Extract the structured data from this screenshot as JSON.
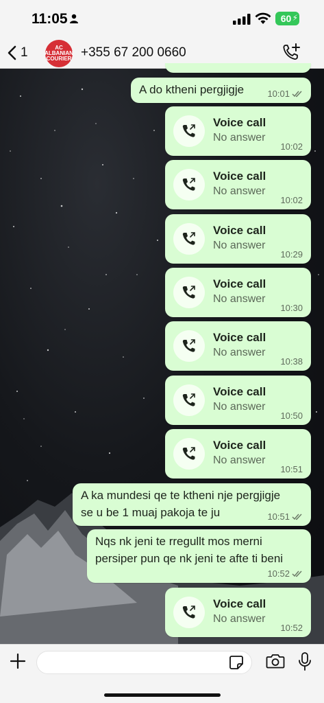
{
  "status_bar": {
    "time": "11:05",
    "battery": "60"
  },
  "header": {
    "back_count": "1",
    "avatar_text": "AC ALBANIAN COURIER",
    "contact": "+355 67 200 0660"
  },
  "messages": [
    {
      "type": "text",
      "text": "A do ktheni pergjigje",
      "time": "10:01",
      "read": true
    },
    {
      "type": "call",
      "title": "Voice call",
      "subtitle": "No answer",
      "time": "10:02"
    },
    {
      "type": "call",
      "title": "Voice call",
      "subtitle": "No answer",
      "time": "10:02"
    },
    {
      "type": "call",
      "title": "Voice call",
      "subtitle": "No answer",
      "time": "10:29"
    },
    {
      "type": "call",
      "title": "Voice call",
      "subtitle": "No answer",
      "time": "10:30"
    },
    {
      "type": "call",
      "title": "Voice call",
      "subtitle": "No answer",
      "time": "10:38"
    },
    {
      "type": "call",
      "title": "Voice call",
      "subtitle": "No answer",
      "time": "10:50"
    },
    {
      "type": "call",
      "title": "Voice call",
      "subtitle": "No answer",
      "time": "10:51"
    },
    {
      "type": "text",
      "line1": "A ka mundesi qe te ktheni nje pergjigje",
      "line2": "se u be 1 muaj pakoja te ju",
      "time": "10:51",
      "read": true
    },
    {
      "type": "text",
      "line1": "Nqs nk jeni te rregullt mos merni",
      "line2": "persiper pun qe nk jeni te afte ti beni",
      "time": "10:52",
      "read": true
    },
    {
      "type": "call",
      "title": "Voice call",
      "subtitle": "No answer",
      "time": "10:52"
    }
  ],
  "input": {
    "value": "",
    "placeholder": ""
  },
  "colors": {
    "bubble": "#d9fdd3",
    "header_bg": "#f4f4f4",
    "avatar": "#d62f36",
    "battery": "#34c759"
  },
  "icons": [
    "person-icon",
    "signal-icon",
    "wifi-icon",
    "battery-icon",
    "back-chevron-icon",
    "add-call-icon",
    "outgoing-call-icon",
    "double-check-icon",
    "plus-icon",
    "sticker-icon",
    "camera-icon",
    "mic-icon"
  ]
}
